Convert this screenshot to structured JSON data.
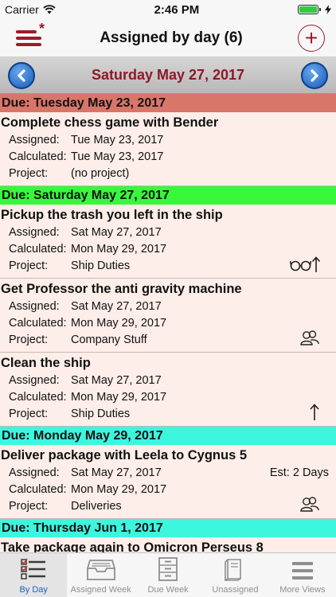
{
  "status": {
    "carrier": "Carrier",
    "time": "2:46 PM"
  },
  "nav": {
    "title": "Assigned by day (6)"
  },
  "date_bar": {
    "title": "Saturday May 27, 2017"
  },
  "labels": {
    "assigned": "Assigned:",
    "calculated": "Calculated:",
    "project": "Project:"
  },
  "sections": [
    {
      "title": "Due: Tuesday May 23, 2017",
      "color": "#d9766a",
      "tasks": [
        {
          "title": "Complete chess game with Bender",
          "assigned": "Tue May 23, 2017",
          "calculated": "Tue May 23, 2017",
          "project": "(no project)"
        }
      ]
    },
    {
      "title": "Due: Saturday May 27, 2017",
      "color": "#38f83a",
      "tasks": [
        {
          "title": "Pickup the trash you left in the ship",
          "assigned": "Sat May 27, 2017",
          "calculated": "Mon May 29, 2017",
          "project": "Ship Duties",
          "icon": "glasses-arrow-up-icon"
        },
        {
          "title": "Get Professor the anti gravity machine",
          "assigned": "Sat May 27, 2017",
          "calculated": "Mon May 29, 2017",
          "project": "Company Stuff",
          "icon": "people-icon"
        },
        {
          "title": "Clean the ship",
          "assigned": "Sat May 27, 2017",
          "calculated": "Mon May 29, 2017",
          "project": "Ship Duties",
          "icon": "arrow-up-icon"
        }
      ]
    },
    {
      "title": "Due: Monday May 29, 2017",
      "color": "#3cf6de",
      "tasks": [
        {
          "title": "Deliver package with Leela to Cygnus 5",
          "assigned": "Sat May 27, 2017",
          "calculated": "Mon May 29, 2017",
          "project": "Deliveries",
          "estimate": "Est: 2 Days",
          "icon": "people-icon"
        }
      ]
    },
    {
      "title": "Due: Thursday Jun 1, 2017",
      "color": "#3cf6de",
      "tasks": [
        {
          "title": "Take package again to Omicron Perseus 8"
        }
      ]
    }
  ],
  "tabs": [
    {
      "label": "By Day",
      "icon": "checklist-icon",
      "active": true
    },
    {
      "label": "Assigned Week",
      "icon": "inbox-tray-icon",
      "active": false
    },
    {
      "label": "Due Week",
      "icon": "cabinet-icon",
      "active": false
    },
    {
      "label": "Unassigned",
      "icon": "books-icon",
      "active": false
    },
    {
      "label": "More Views",
      "icon": "hamburger-icon",
      "active": false
    }
  ]
}
